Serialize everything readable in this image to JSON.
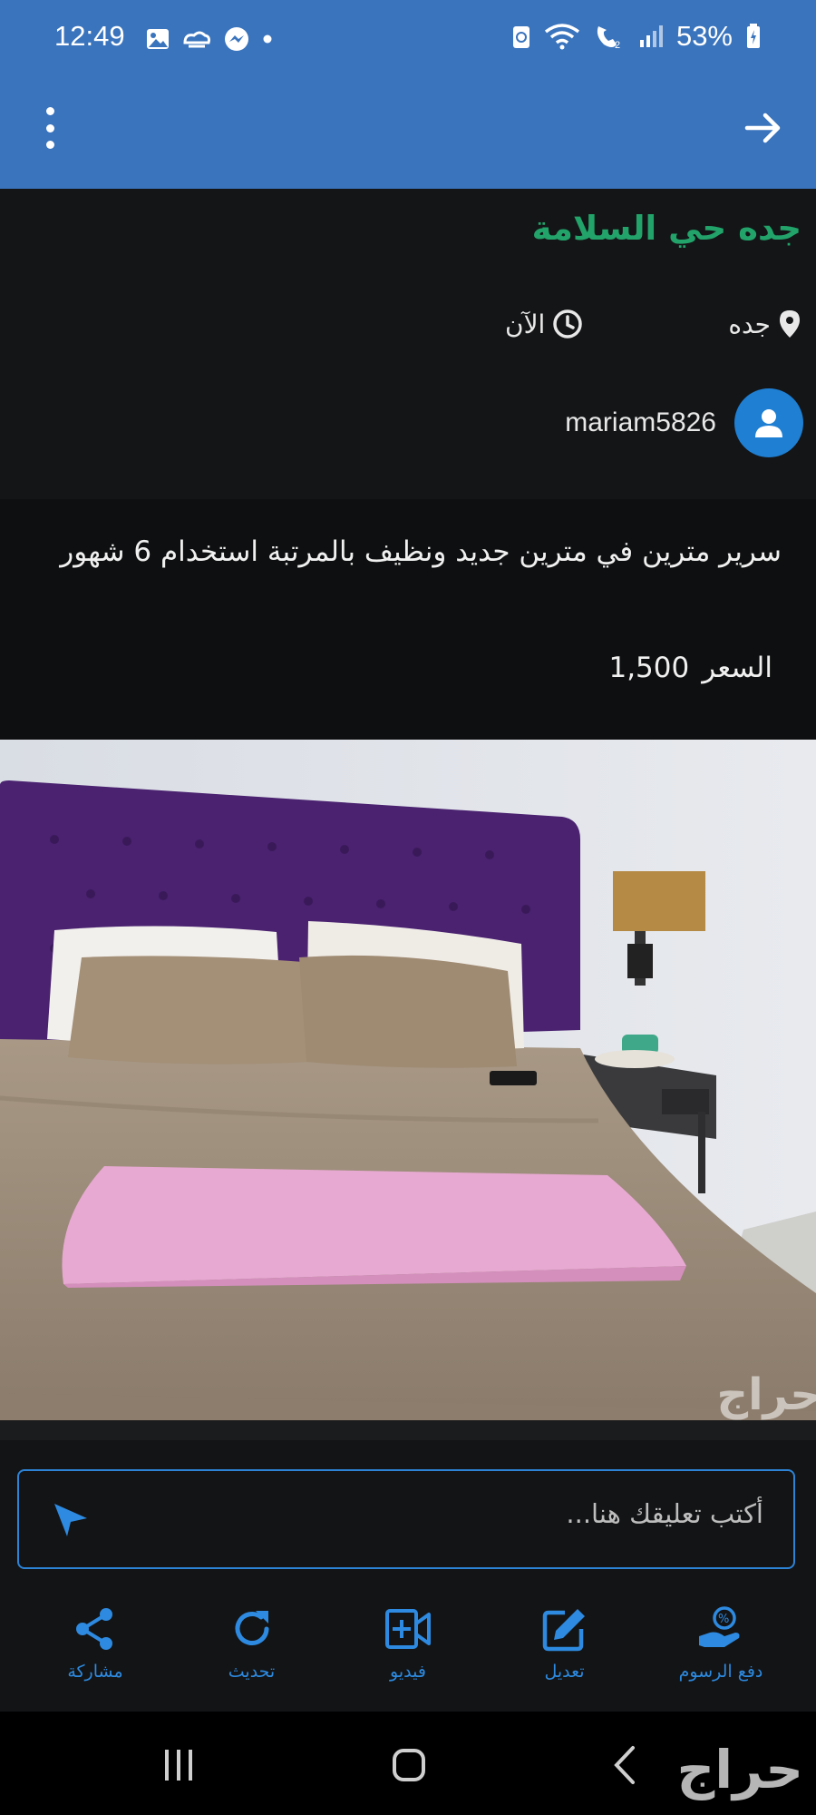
{
  "status_bar": {
    "time": "12:49",
    "battery": "53%",
    "icons": [
      "image-icon",
      "cloud-icon",
      "messenger-icon",
      "dot-icon",
      "recycle-icon",
      "wifi-icon",
      "call-icon",
      "signal-icon",
      "battery-icon"
    ]
  },
  "app_bar": {
    "menu_icon": "more-vert-icon",
    "back_icon": "arrow-right-icon"
  },
  "listing": {
    "location_title": "جده حي السلامة",
    "city": "جده",
    "time_posted": "الآن",
    "username": "mariam5826",
    "title": "سرير مترين في مترين جديد ونظيف بالمرتبة استخدام 6 شهور",
    "price_label": "السعر",
    "price_value": "1,500"
  },
  "photo": {
    "watermark": "حراج"
  },
  "comment": {
    "placeholder": "أكتب تعليقك هنا..."
  },
  "actions": [
    {
      "label": "مشاركة",
      "icon": "share-icon"
    },
    {
      "label": "تحديث",
      "icon": "refresh-icon"
    },
    {
      "label": "فيديو",
      "icon": "video-add-icon"
    },
    {
      "label": "تعديل",
      "icon": "edit-icon"
    },
    {
      "label": "دفع الرسوم",
      "icon": "pay-fees-icon"
    }
  ],
  "nav_bar": {
    "watermark": "حراج"
  },
  "colors": {
    "app_bar": "#3a74bd",
    "accent_green": "#22a36a",
    "accent_blue": "#2d8ae0",
    "headboard_purple": "#4a2270"
  }
}
